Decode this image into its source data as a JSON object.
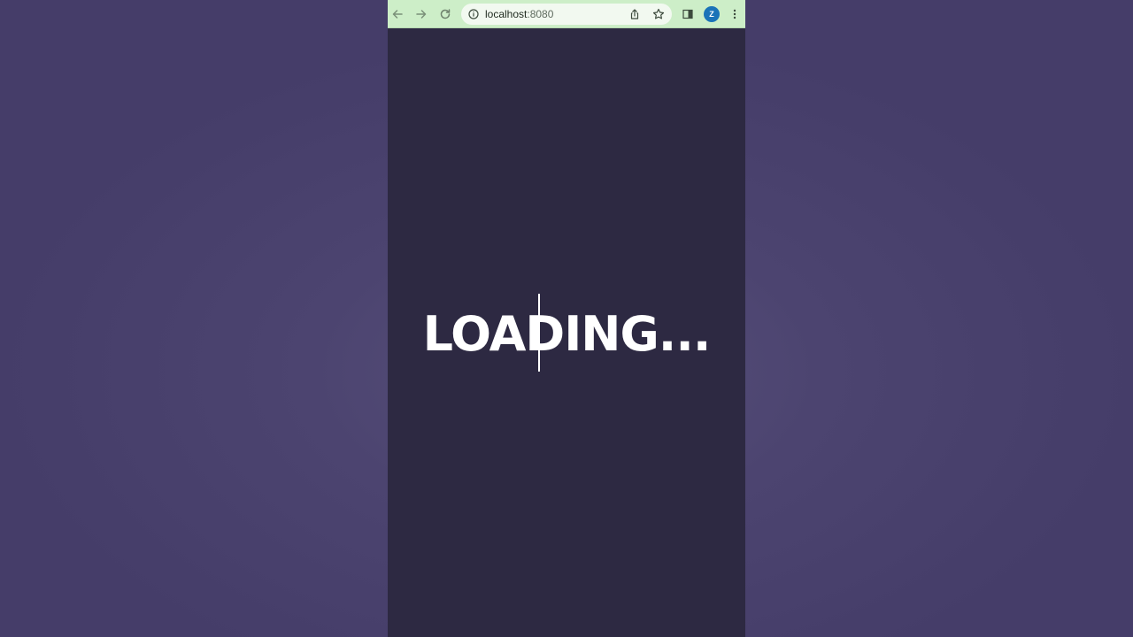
{
  "browser": {
    "url_host": "localhost",
    "url_port": ":8080",
    "profile_initial": "Z"
  },
  "icons": {
    "back": "arrow-left-icon",
    "forward": "arrow-right-icon",
    "reload": "reload-icon",
    "site_info": "info-circle-icon",
    "share": "share-icon",
    "bookmark": "star-icon",
    "side_panel": "side-panel-icon",
    "menu": "kebab-menu-icon"
  },
  "colors": {
    "toolbar": "#cdeec8",
    "page_background": "#2d2942",
    "outer_background": "#4c4470",
    "text": "#ffffff",
    "avatar": "#1a73b8"
  },
  "page": {
    "loading_text": "LOADING..."
  }
}
